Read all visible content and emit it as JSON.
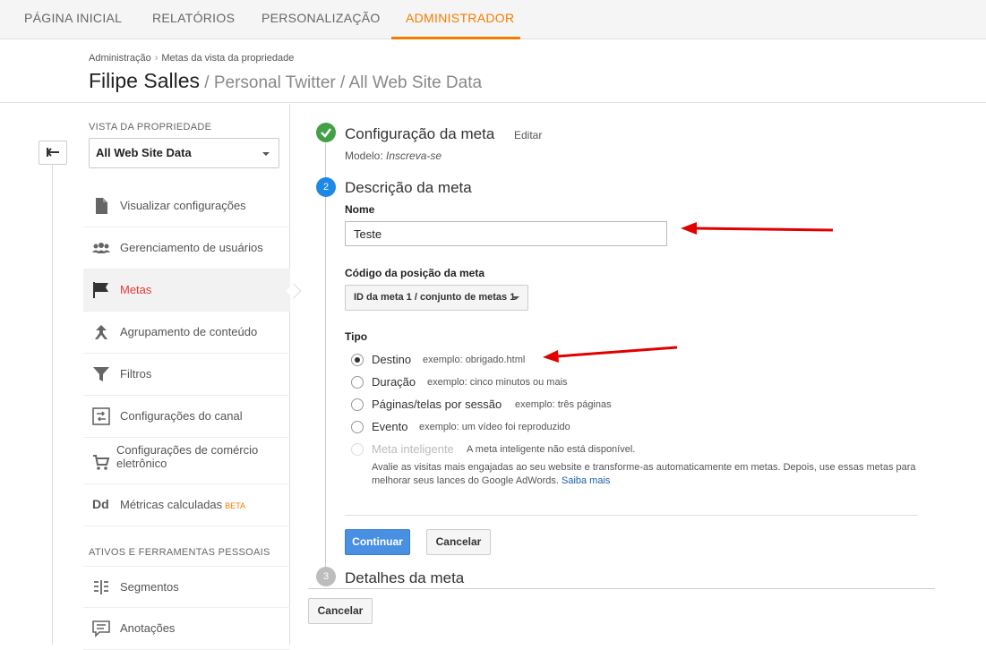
{
  "topnav": {
    "tabs": [
      {
        "label": "PÁGINA INICIAL"
      },
      {
        "label": "RELATÓRIOS"
      },
      {
        "label": "PERSONALIZAÇÃO"
      },
      {
        "label": "ADMINISTRADOR"
      }
    ],
    "active_tab": "ADMINISTRADOR"
  },
  "header": {
    "breadcrumb": [
      "Administração",
      "Metas da vista da propriedade"
    ],
    "breadcrumb_separator": "›",
    "title_main": "Filipe Salles",
    "title_sub": " / Personal Twitter / All Web Site Data"
  },
  "sidebar": {
    "section_view_label": "VISTA DA PROPRIEDADE",
    "view_select_value": "All Web Site Data",
    "items": [
      {
        "label": "Visualizar configurações",
        "icon": "document-icon"
      },
      {
        "label": "Gerenciamento de usuários",
        "icon": "users-icon"
      },
      {
        "label": "Metas",
        "icon": "flag-icon",
        "active": true
      },
      {
        "label": "Agrupamento de conteúdo",
        "icon": "content-grouping-icon"
      },
      {
        "label": "Filtros",
        "icon": "filter-icon"
      },
      {
        "label": "Configurações do canal",
        "icon": "channel-settings-icon"
      },
      {
        "label": "Configurações de comércio eletrônico",
        "icon": "cart-icon"
      },
      {
        "label": "Métricas calculadas",
        "icon": "calculated-metrics-icon",
        "badge": "BETA"
      }
    ],
    "section_personal_label": "ATIVOS E FERRAMENTAS PESSOAIS",
    "personal_items": [
      {
        "label": "Segmentos",
        "icon": "segments-icon"
      },
      {
        "label": "Anotações",
        "icon": "annotations-icon"
      }
    ]
  },
  "steps": {
    "step1": {
      "title": "Configuração da meta",
      "edit_label": "Editar",
      "model_prefix": "Modelo: ",
      "model_value": "Inscreva-se"
    },
    "step2": {
      "number": "2",
      "title": "Descrição da meta"
    },
    "step3": {
      "number": "3",
      "title": "Detalhes da meta"
    }
  },
  "form": {
    "name_label": "Nome",
    "name_value": "Teste",
    "position_label": "Código da posição da meta",
    "position_value": "ID da meta 1 / conjunto de metas 1",
    "type_label": "Tipo",
    "types": [
      {
        "label": "Destino",
        "example": "exemplo: obrigado.html",
        "checked": true
      },
      {
        "label": "Duração",
        "example": "exemplo: cinco minutos ou mais"
      },
      {
        "label": "Páginas/telas por sessão",
        "example": "exemplo: três páginas"
      },
      {
        "label": "Evento",
        "example": "exemplo: um vídeo foi reproduzido"
      },
      {
        "label": "Meta inteligente",
        "example": "A meta inteligente não está disponível.",
        "disabled": true
      }
    ],
    "smart_description": "Avalie as visitas mais engajadas ao seu website e transforme-as automaticamente em metas. Depois, use essas metas para melhorar seus lances do Google AdWords.",
    "smart_link": "Saiba mais",
    "continue_label": "Continuar",
    "cancel_label": "Cancelar",
    "bottom_cancel_label": "Cancelar"
  },
  "colors": {
    "accent": "#f57c00",
    "active_nav": "#e53935",
    "primary_button": "#4a90e2",
    "step_done": "#43a047",
    "step_current": "#1e88e5",
    "step_pending": "#bdbdbd",
    "annotation_arrow": "#e00000"
  }
}
